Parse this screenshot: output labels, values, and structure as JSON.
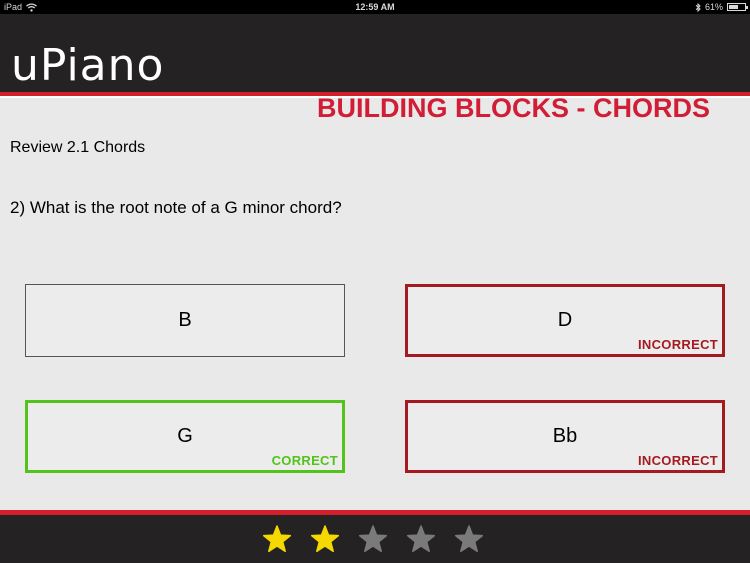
{
  "status": {
    "device": "iPad",
    "time": "12:59 AM",
    "battery": "61%",
    "battery_level": 0.61
  },
  "header": {
    "app_title": "uPiano",
    "section_title": "BUILDING BLOCKS - CHORDS"
  },
  "quiz": {
    "review_label": "Review 2.1 Chords",
    "question": "2) What is the root note of a G minor chord?",
    "answers": [
      {
        "label": "B",
        "verdict": "",
        "state": "neutral"
      },
      {
        "label": "D",
        "verdict": "INCORRECT",
        "state": "incorrect"
      },
      {
        "label": "G",
        "verdict": "CORRECT",
        "state": "correct"
      },
      {
        "label": "Bb",
        "verdict": "INCORRECT",
        "state": "incorrect"
      }
    ]
  },
  "rating": {
    "stars_filled": 2,
    "stars_total": 5,
    "filled_color": "#f5d800",
    "empty_color": "#7a7a7a"
  },
  "colors": {
    "accent_red": "#d11d35",
    "incorrect_red": "#a51a21",
    "correct_green": "#53c21a",
    "header_bg": "#242222"
  }
}
